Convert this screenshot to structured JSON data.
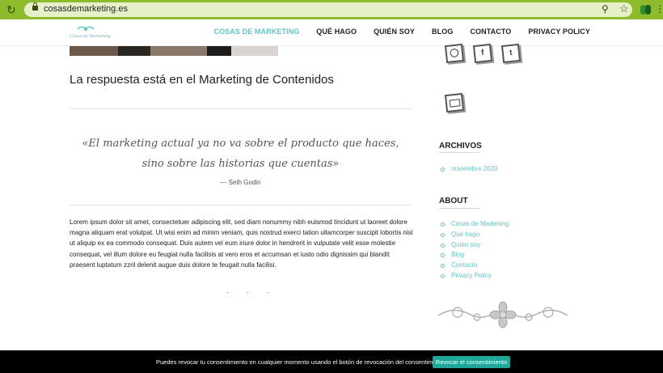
{
  "browser": {
    "url": "cosasdemarketing.es",
    "icons": [
      "reload-icon",
      "lock-icon",
      "search-icon",
      "star-icon",
      "extension-icon",
      "menu-icon"
    ]
  },
  "header": {
    "logo_text": "Cosas de Marketing",
    "nav": [
      {
        "label": "COSAS DE MARKETING",
        "active": true
      },
      {
        "label": "QUÉ HAGO",
        "active": false
      },
      {
        "label": "QUIÉN SOY",
        "active": false
      },
      {
        "label": "BLOG",
        "active": false
      },
      {
        "label": "CONTACTO",
        "active": false
      },
      {
        "label": "PRIVACY POLICY",
        "active": false
      }
    ]
  },
  "main": {
    "title": "La respuesta está en el Marketing de Contenidos",
    "quote": "«El marketing actual ya no va sobre el producto que haces, sino sobre las historias que cuentas»",
    "quote_author": "— Seth Godin",
    "body": "Lorem ipsum dolor sit amet, consectetuer adipiscing elit, sed diam nonummy nibh euismod tincidunt ut laoreet dolore magna aliquam erat volutpat. Ut wisi enim ad minim veniam, quis nostrud exerci tation ullamcorper suscipit lobortis nisl ut aliquip ex ea commodo consequat. Duis autem vel eum iriure dolor in hendrerit in vulputate velit esse molestie consequat, vel illum dolore eu feugiat nulla facilisis at vero eros et accumsan et iusto odio dignissim qui blandit praesent luptatum zzril delenit augue duis dolore te feugait nulla facilisi.",
    "dots": "· · ·"
  },
  "sidebar": {
    "social_icons": [
      "instagram-icon",
      "facebook-icon",
      "twitter-icon",
      "mail-icon"
    ],
    "archives": {
      "title": "ARCHIVOS",
      "items": [
        "noviembre 2020"
      ]
    },
    "about": {
      "title": "ABOUT",
      "items": [
        "Cosas de Marketing",
        "Qué hago",
        "Quién soy",
        "Blog",
        "Contacto",
        "Privacy Policy"
      ]
    }
  },
  "cookie": {
    "text": "Puedes revocar tu consentimiento en cualquier momento usando el botón de revocación del consentimiento.",
    "button": "Revocar el consentimiento"
  },
  "colors": {
    "browser_bar": "#8dbb2b",
    "accent": "#5cc6c3",
    "cookie_button": "#1fa89a"
  }
}
